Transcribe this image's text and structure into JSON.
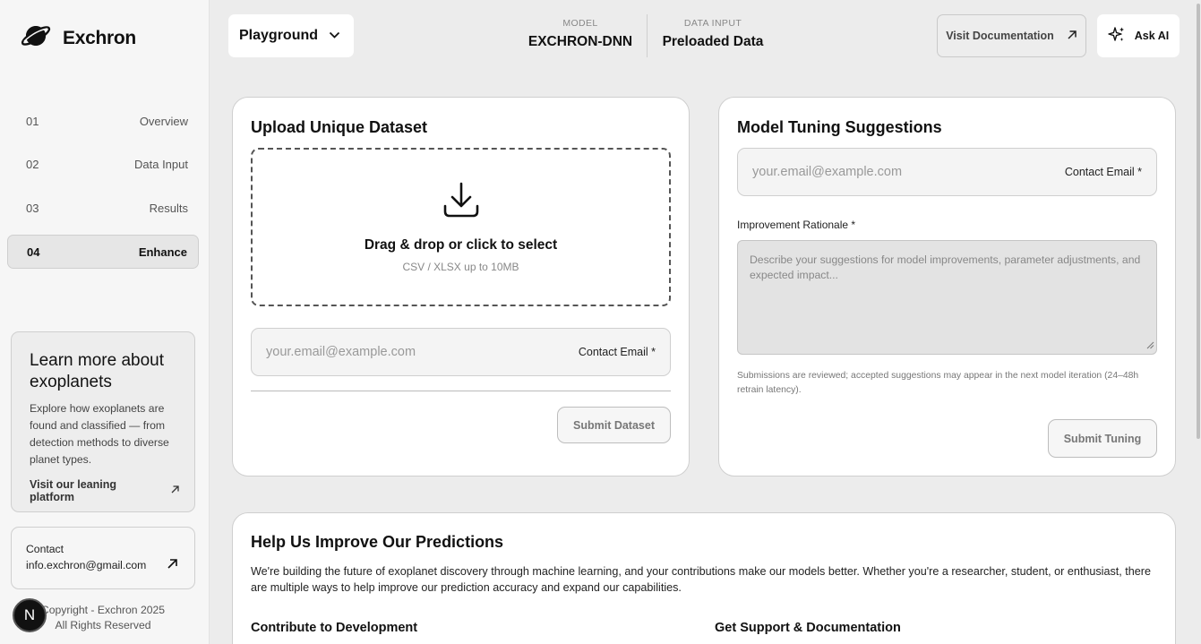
{
  "brand": {
    "name": "Exchron",
    "logo_icon": "planet-icon"
  },
  "nav": [
    {
      "num": "01",
      "label": "Overview",
      "active": false
    },
    {
      "num": "02",
      "label": "Data Input",
      "active": false
    },
    {
      "num": "03",
      "label": "Results",
      "active": false
    },
    {
      "num": "04",
      "label": "Enhance",
      "active": true
    }
  ],
  "learn": {
    "title": "Learn more about exoplanets",
    "text": "Explore how exoplanets are found and classified — from detection methods to diverse planet types.",
    "link": "Visit our leaning platform"
  },
  "contact": {
    "label": "Contact",
    "email": "info.exchron@gmail.com"
  },
  "footer": {
    "copyright_line1": "Copyright - Exchron 2025",
    "copyright_line2": "All Rights Reserved",
    "badge": "N"
  },
  "header": {
    "mode": "Playground",
    "model_label": "MODEL",
    "model_value": "EXCHRON-DNN",
    "data_label": "DATA INPUT",
    "data_value": "Preloaded Data",
    "docs_button": "Visit Documentation",
    "ai_button": "Ask AI"
  },
  "upload": {
    "title": "Upload Unique Dataset",
    "drop_title": "Drag & drop or click to select",
    "drop_sub": "CSV / XLSX up to 10MB",
    "email_placeholder": "your.email@example.com",
    "email_label": "Contact Email *",
    "submit": "Submit Dataset"
  },
  "tuning": {
    "title": "Model Tuning Suggestions",
    "email_placeholder": "your.email@example.com",
    "email_label": "Contact Email *",
    "rationale_label": "Improvement Rationale *",
    "rationale_placeholder": "Describe your suggestions for model improvements, parameter adjustments, and expected impact...",
    "note": "Submissions are reviewed; accepted suggestions may appear in the next model iteration (24–48h retrain latency).",
    "submit": "Submit Tuning"
  },
  "help": {
    "title": "Help Us Improve Our Predictions",
    "text": "We're building the future of exoplanet discovery through machine learning, and your contributions make our models better. Whether you're a researcher, student, or enthusiast, there are multiple ways to help improve our prediction accuracy and expand our capabilities.",
    "col1_title": "Contribute to Development",
    "col2_title": "Get Support & Documentation"
  }
}
